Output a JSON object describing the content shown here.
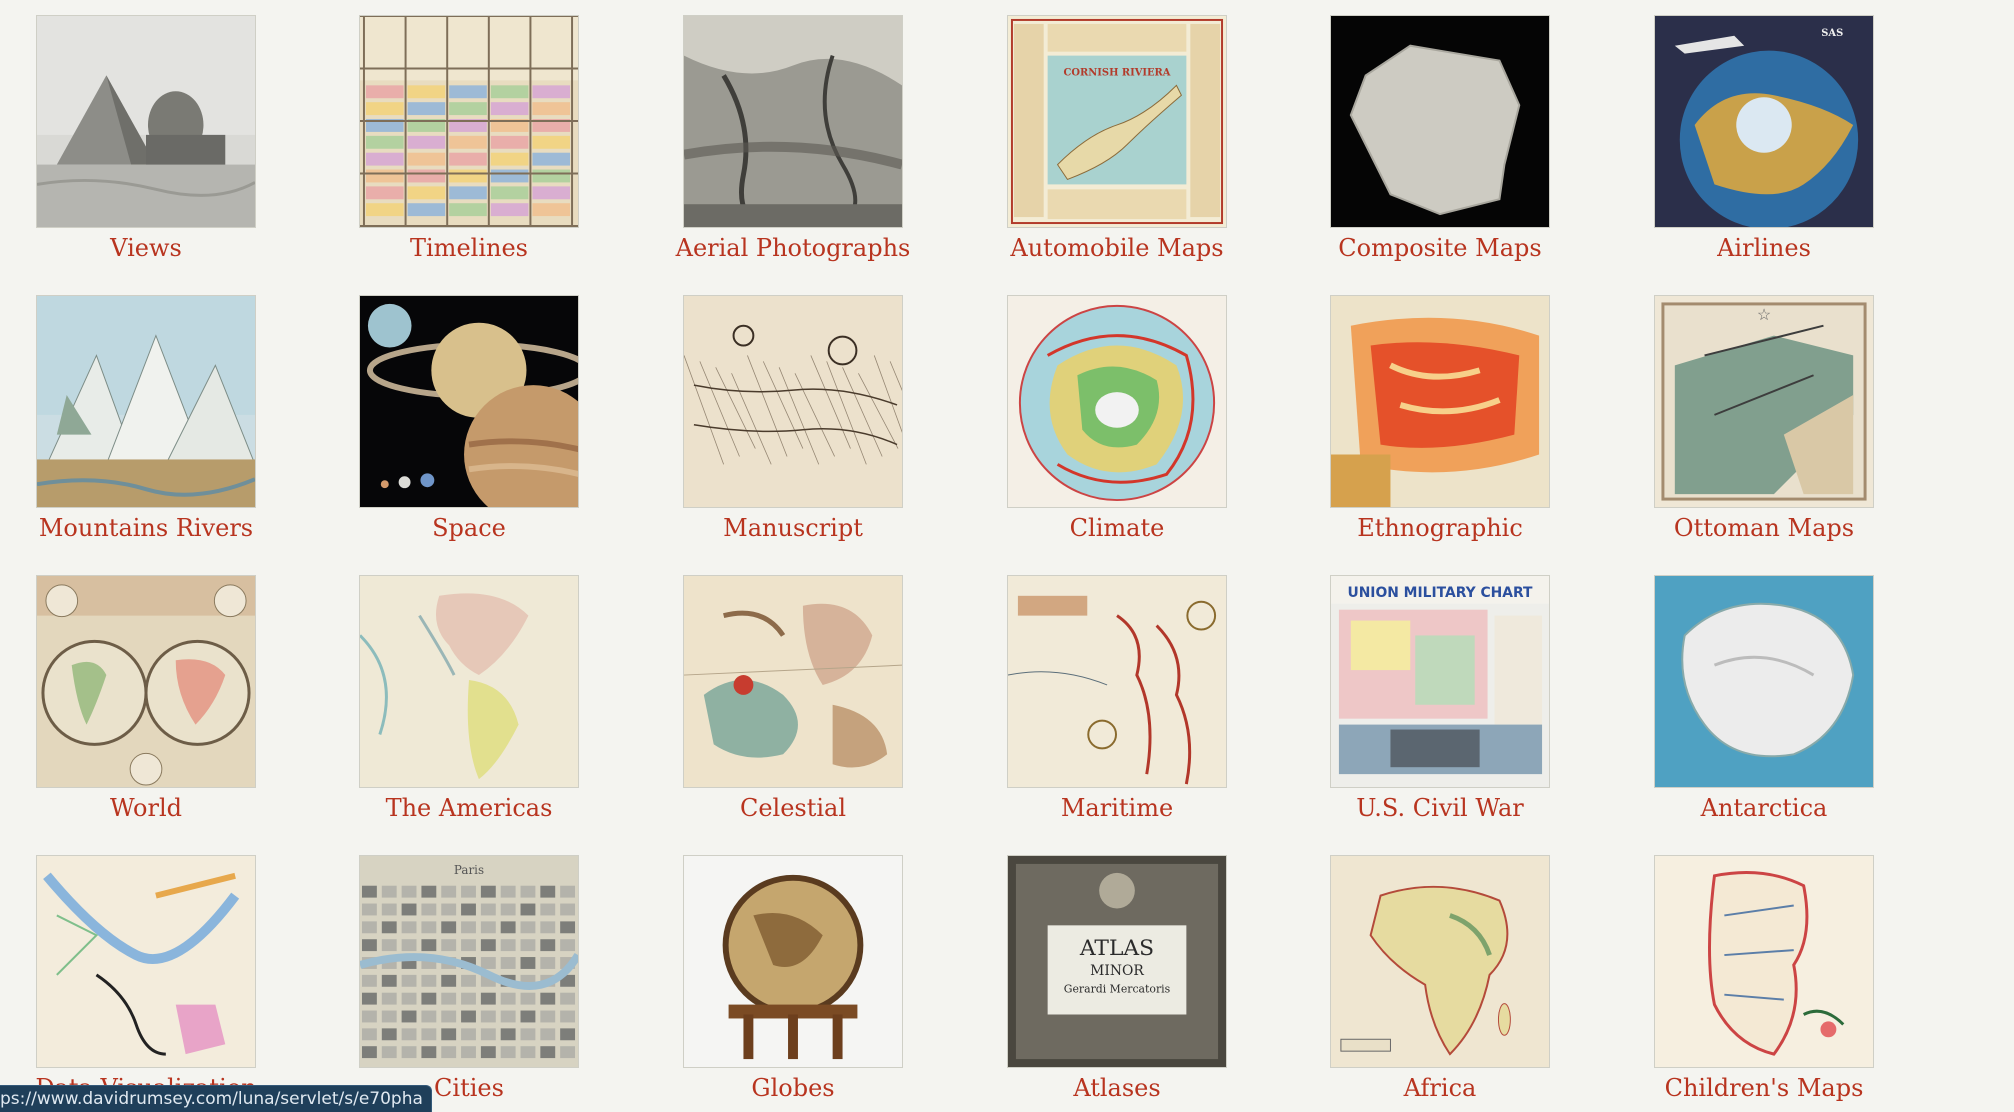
{
  "gallery": {
    "tiles": [
      {
        "label": "Views",
        "theme": "views"
      },
      {
        "label": "Timelines",
        "theme": "timelines"
      },
      {
        "label": "Aerial Photographs",
        "theme": "aerial"
      },
      {
        "label": "Automobile Maps",
        "theme": "automobile"
      },
      {
        "label": "Composite Maps",
        "theme": "composite"
      },
      {
        "label": "Airlines",
        "theme": "airlines"
      },
      {
        "label": "Mountains Rivers",
        "theme": "mountains"
      },
      {
        "label": "Space",
        "theme": "space"
      },
      {
        "label": "Manuscript",
        "theme": "manuscript"
      },
      {
        "label": "Climate",
        "theme": "climate"
      },
      {
        "label": "Ethnographic",
        "theme": "ethnographic"
      },
      {
        "label": "Ottoman Maps",
        "theme": "ottoman"
      },
      {
        "label": "World",
        "theme": "world"
      },
      {
        "label": "The Americas",
        "theme": "americas"
      },
      {
        "label": "Celestial",
        "theme": "celestial"
      },
      {
        "label": "Maritime",
        "theme": "maritime"
      },
      {
        "label": "U.S. Civil War",
        "theme": "civilwar"
      },
      {
        "label": "Antarctica",
        "theme": "antarctica"
      },
      {
        "label": "Data Visualization",
        "theme": "dataviz"
      },
      {
        "label": "Cities",
        "theme": "cities"
      },
      {
        "label": "Globes",
        "theme": "globes"
      },
      {
        "label": "Atlases",
        "theme": "atlases"
      },
      {
        "label": "Africa",
        "theme": "africa"
      },
      {
        "label": "Children's Maps",
        "theme": "children"
      }
    ],
    "thumbnail_text": {
      "automobile_title": "CORNISH RIVIERA",
      "civilwar_title": "UNION MILITARY CHART",
      "atlas_line1": "ATLAS",
      "atlas_line2": "MINOR",
      "atlas_line3": "Gerardi Mercatoris",
      "cities_title": "Paris",
      "airlines_brand": "SAS"
    }
  },
  "status_bar": {
    "url": "ps://www.davidrumsey.com/luna/servlet/s/e70pha"
  },
  "colors": {
    "background": "#f4f4f0",
    "link": "#b8341f",
    "status_bar": "#1f3f5a"
  }
}
